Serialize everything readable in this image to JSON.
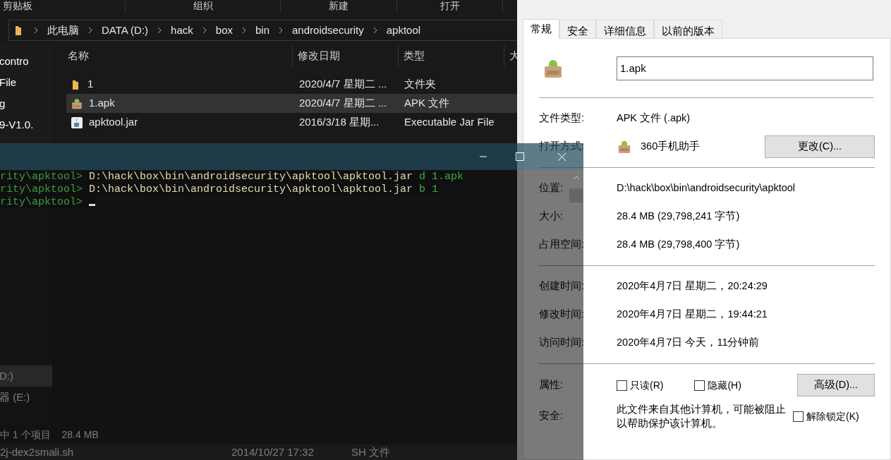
{
  "explorer": {
    "ribbon_groups": [
      "剪贴板",
      "组织",
      "新建",
      "打开"
    ],
    "breadcrumb": [
      "此电脑",
      "DATA (D:)",
      "hack",
      "box",
      "bin",
      "androidsecurity",
      "apktool"
    ],
    "sidebar_items": [
      {
        "label": "contro",
        "selected": false
      },
      {
        "label": "File",
        "selected": false
      },
      {
        "label": "g",
        "selected": false
      },
      {
        "label": "9-V1.0.",
        "selected": false
      },
      {
        "label": "D:)",
        "selected": true
      },
      {
        "label": "器 (E:)",
        "selected": false
      }
    ],
    "columns": [
      "名称",
      "修改日期",
      "类型",
      "大"
    ],
    "rows": [
      {
        "kind": "folder",
        "name": "1",
        "date": "2020/4/7 星期二 ...",
        "type": "文件夹",
        "selected": false
      },
      {
        "kind": "apk",
        "name": "1.apk",
        "date": "2020/4/7 星期二 ...",
        "type": "APK 文件",
        "selected": true
      },
      {
        "kind": "jar",
        "name": "apktool.jar",
        "date": "2016/3/18 星期...",
        "type": "Executable Jar File",
        "selected": false
      }
    ],
    "status": [
      "中 1 个项目",
      "28.4 MB"
    ],
    "behind_row": {
      "name": "2j-dex2smali.sh",
      "date": "2014/10/27 17:32",
      "type": "SH 文件"
    }
  },
  "console": {
    "lines": [
      {
        "prompt": "rity\\apktool>",
        "command": "D:\\hack\\box\\bin\\androidsecurity\\apktool\\apktool.jar",
        "args": "d 1.apk",
        "cursor": false
      },
      {
        "prompt": "rity\\apktool>",
        "command": "D:\\hack\\box\\bin\\androidsecurity\\apktool\\apktool.jar",
        "args": "b 1",
        "cursor": false
      },
      {
        "prompt": "rity\\apktool>",
        "cursor": true
      }
    ]
  },
  "properties": {
    "tabs": [
      {
        "label": "常规",
        "selected": true
      },
      {
        "label": "安全",
        "selected": false
      },
      {
        "label": "详细信息",
        "selected": false
      },
      {
        "label": "以前的版本",
        "selected": false
      }
    ],
    "file_name": "1.apk",
    "sections": [
      [
        {
          "kind": "text",
          "label": "文件类型:",
          "value": "APK 文件 (.apk)"
        },
        {
          "kind": "app",
          "label": "打开方式:",
          "value": "360手机助手",
          "button": "更改(C)..."
        }
      ],
      [
        {
          "kind": "text",
          "label": "位置:",
          "value": "D:\\hack\\box\\bin\\androidsecurity\\apktool"
        },
        {
          "kind": "text",
          "label": "大小:",
          "value": "28.4 MB (29,798,241 字节)"
        },
        {
          "kind": "text",
          "label": "占用空间:",
          "value": "28.4 MB (29,798,400 字节)"
        }
      ],
      [
        {
          "kind": "text",
          "label": "创建时间:",
          "value": "2020年4月7日 星期二，20:24:29"
        },
        {
          "kind": "text",
          "label": "修改时间:",
          "value": "2020年4月7日 星期二，19:44:21"
        },
        {
          "kind": "text",
          "label": "访问时间:",
          "value": "2020年4月7日 今天，11分钟前"
        }
      ],
      [
        {
          "kind": "attributes",
          "label": "属性:",
          "checkboxes": [
            {
              "label": "只读(R)",
              "checked": false
            },
            {
              "label": "隐藏(H)",
              "checked": false
            }
          ],
          "button": "高级(D)..."
        },
        {
          "kind": "security",
          "label": "安全:",
          "value": "此文件来自其他计算机，可能被阻止以帮助保护该计算机。",
          "checkbox": {
            "label": "解除锁定(K)",
            "checked": false
          }
        }
      ]
    ]
  }
}
